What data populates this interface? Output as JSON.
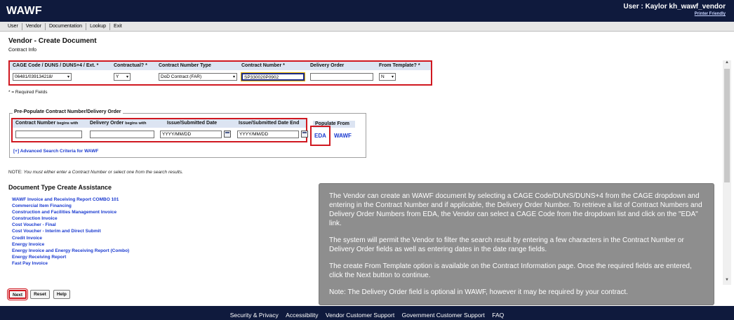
{
  "app": {
    "title": "WAWF",
    "user_label": "User : Kaylor kh_wawf_vendor",
    "printer_friendly": "Printer Friendly"
  },
  "menu": {
    "items": [
      "User",
      "Vendor",
      "Documentation",
      "Lookup",
      "Exit"
    ]
  },
  "page": {
    "title": "Vendor - Create Document",
    "section": "Contract Info"
  },
  "contract_info": {
    "headers": [
      "CAGE Code / DUNS / DUNS+4 / Ext. *",
      "Contractual? *",
      "Contract Number Type",
      "Contract Number *",
      "Delivery Order",
      "From Template? *"
    ],
    "cage_value": "06481/039134218/",
    "contractual_value": "Y",
    "number_type_value": "DoD Contract (FAR)",
    "contract_number_value": "SP330020P0902",
    "delivery_order_value": "",
    "template_value": "N"
  },
  "required_note": "* = Required Fields",
  "prepopulate": {
    "legend": "Pre-Populate Contract Number/Delivery Order",
    "contract_head": "Contract Number",
    "contract_head_small": "begins with",
    "delivery_head": "Delivery Order",
    "delivery_head_small": "begins with",
    "issue_head": "Issue/Submitted Date",
    "end_head": "Issue/Submitted Date End",
    "date_placeholder": "YYYY/MM/DD",
    "populate_head": "Populate From",
    "eda_link": "EDA",
    "wawf_link": "WAWF",
    "advanced_link": "[+] Advanced Search Criteria for WAWF"
  },
  "note": {
    "prefix": "NOTE: ",
    "text": "You must either enter a Contract Number or select one from the search results."
  },
  "doc_types": {
    "title": "Document Type Create Assistance",
    "items": [
      "WAWF Invoice and Receiving Report COMBO 101",
      "Commercial Item Financing",
      "Construction and Facilities Management Invoice",
      "Construction Invoice",
      "Cost Voucher - Final",
      "Cost Voucher - Interim and Direct Submit",
      "Credit Invoice",
      "Energy Invoice",
      "Energy Invoice and Energy Receiving Report (Combo)",
      "Energy Receiving Report",
      "Fast Pay Invoice"
    ]
  },
  "buttons": {
    "next": "Next",
    "reset": "Reset",
    "help": "Help"
  },
  "footer": {
    "links": [
      "Security & Privacy",
      "Accessibility",
      "Vendor Customer Support",
      "Government Customer Support",
      "FAQ"
    ]
  },
  "tooltip": {
    "paragraphs": [
      "The Vendor can create an WAWF document by selecting a CAGE Code/DUNS/DUNS+4 from the CAGE dropdown and entering in the Contract Number and if applicable, the Delivery Order Number. To retrieve a list of Contract Numbers and Delivery Order Numbers from EDA, the Vendor can select a CAGE Code from the dropdown list and click on the \"EDA\" link.",
      "The system will permit the Vendor to filter the search result by entering a few characters in the Contract Number or Delivery Order fields as well as entering dates in the date range fields.",
      "The create From Template option is available on the Contract Information page. Once the required fields are entered, click the Next button to continue.",
      "Note: The Delivery Order field is optional in WAWF, however it may be required by your contract."
    ]
  },
  "colors": {
    "header_bg": "#0f1a3d",
    "highlight_red": "#d01820",
    "link_blue": "#1a3ad0",
    "tooltip_bg": "#8e8e8e",
    "table_head_bg": "#dce4f2"
  },
  "icons": {
    "calendar": "calendar-icon",
    "dropdown": "chevron-down-icon"
  }
}
